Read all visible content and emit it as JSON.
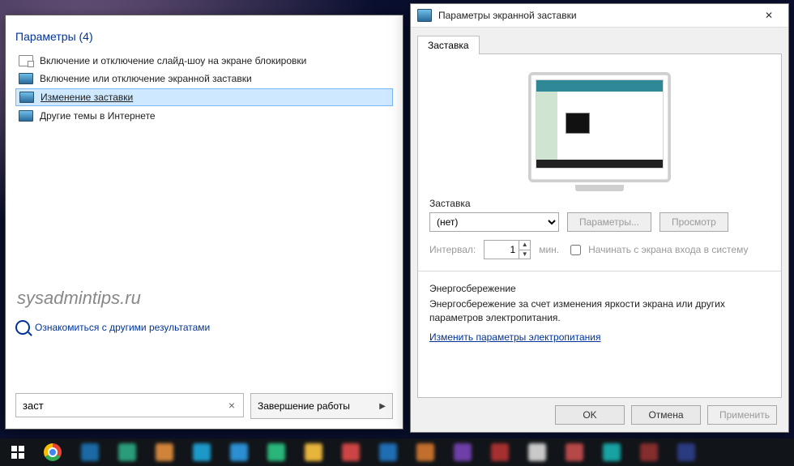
{
  "search": {
    "heading": "Параметры (4)",
    "items": [
      {
        "label": "Включение и отключение слайд-шоу на экране блокировки"
      },
      {
        "label": "Включение или отключение экранной заставки"
      },
      {
        "label": "Изменение заставки"
      },
      {
        "label": "Другие темы в Интернете"
      }
    ],
    "watermark": "sysadmintips.ru",
    "more_link": "Ознакомиться с другими результатами",
    "query": "заст",
    "shutdown": "Завершение работы"
  },
  "ss": {
    "title": "Параметры экранной заставки",
    "tab": "Заставка",
    "group_saver": "Заставка",
    "select_value": "(нет)",
    "btn_params": "Параметры...",
    "btn_preview": "Просмотр",
    "interval_label": "Интервал:",
    "interval_value": "1",
    "interval_unit": "мин.",
    "cb_onresume": "Начинать с экрана входа в систему",
    "group_energy": "Энергосбережение",
    "energy_text": "Энергосбережение за счет изменения яркости экрана или других параметров электропитания.",
    "energy_link": "Изменить параметры электропитания",
    "btn_ok": "OK",
    "btn_cancel": "Отмена",
    "btn_apply": "Применить"
  },
  "taskbar": {
    "colors": [
      "#1b6aa5",
      "#2a9c79",
      "#d0843a",
      "#1d99c9",
      "#2b8fd1",
      "#2ab57a",
      "#e7b43c",
      "#cc4444",
      "#1f6db3",
      "#c26f2e",
      "#6e3fa8",
      "#a63030",
      "#c9c9c9",
      "#b74848",
      "#18a2a2",
      "#862d2d",
      "#2b3b80"
    ]
  }
}
